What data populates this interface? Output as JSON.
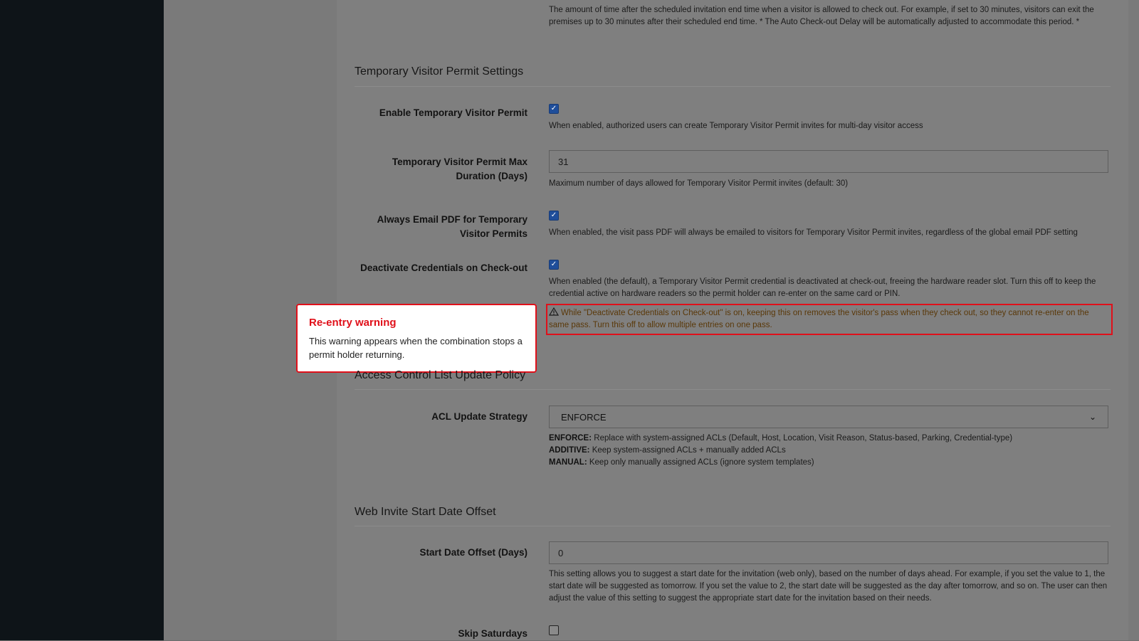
{
  "top_help": "The amount of time after the scheduled invitation end time when a visitor is allowed to check out. For example, if set to 30 minutes, visitors can exit the premises up to 30 minutes after their scheduled end time. * The Auto Check-out Delay will be automatically adjusted to accommodate this period. *",
  "tvp": {
    "title": "Temporary Visitor Permit Settings",
    "enable_label": "Enable Temporary Visitor Permit",
    "enable_help": "When enabled, authorized users can create Temporary Visitor Permit invites for multi-day visitor access",
    "max_label_1": "Temporary Visitor Permit Max",
    "max_label_2": "Duration (Days)",
    "max_value": "31",
    "max_help": "Maximum number of days allowed for Temporary Visitor Permit invites (default: 30)",
    "email_label_1": "Always Email PDF for Temporary",
    "email_label_2": "Visitor Permits",
    "email_help": "When enabled, the visit pass PDF will always be emailed to visitors for Temporary Visitor Permit invites, regardless of the global email PDF setting",
    "deactivate_label": "Deactivate Credentials on Check-out",
    "deactivate_help": "When enabled (the default), a Temporary Visitor Permit credential is deactivated at check-out, freeing the hardware reader slot. Turn this off to keep the credential active on hardware readers so the permit holder can re-enter on the same card or PIN.",
    "warning": "While \"Deactivate Credentials on Check-out\" is on, keeping this on removes the visitor's pass when they check out, so they cannot re-enter on the same pass. Turn this off to allow multiple entries on one pass."
  },
  "callout": {
    "title": "Re-entry warning",
    "body": "This warning appears when the combination stops a permit holder returning."
  },
  "acl": {
    "title": "Access Control List Update Policy",
    "strategy_label": "ACL Update Strategy",
    "strategy_value": "ENFORCE",
    "enforce_key": "ENFORCE:",
    "enforce_text": "Replace with system-assigned ACLs (Default, Host, Location, Visit Reason, Status-based, Parking, Credential-type)",
    "additive_key": "ADDITIVE:",
    "additive_text": "Keep system-assigned ACLs + manually added ACLs",
    "manual_key": "MANUAL:",
    "manual_text": "Keep only manually assigned ACLs (ignore system templates)"
  },
  "web": {
    "title": "Web Invite Start Date Offset",
    "offset_label": "Start Date Offset (Days)",
    "offset_value": "0",
    "offset_help": "This setting allows you to suggest a start date for the invitation (web only), based on the number of days ahead. For example, if you set the value to 1, the start date will be suggested as tomorrow. If you set the value to 2, the start date will be suggested as the day after tomorrow, and so on. The user can then adjust the value of this setting to suggest the appropriate start date for the invitation based on their needs.",
    "skip_sat_label": "Skip Saturdays"
  },
  "colors": {
    "accent_red": "#e0101a",
    "checkbox_blue": "#1f4e9a",
    "warning_text": "#5a3808"
  },
  "icons": {
    "warning": "warning-triangle-icon",
    "check": "checkmark-icon",
    "select": "chevron-down-icon"
  }
}
